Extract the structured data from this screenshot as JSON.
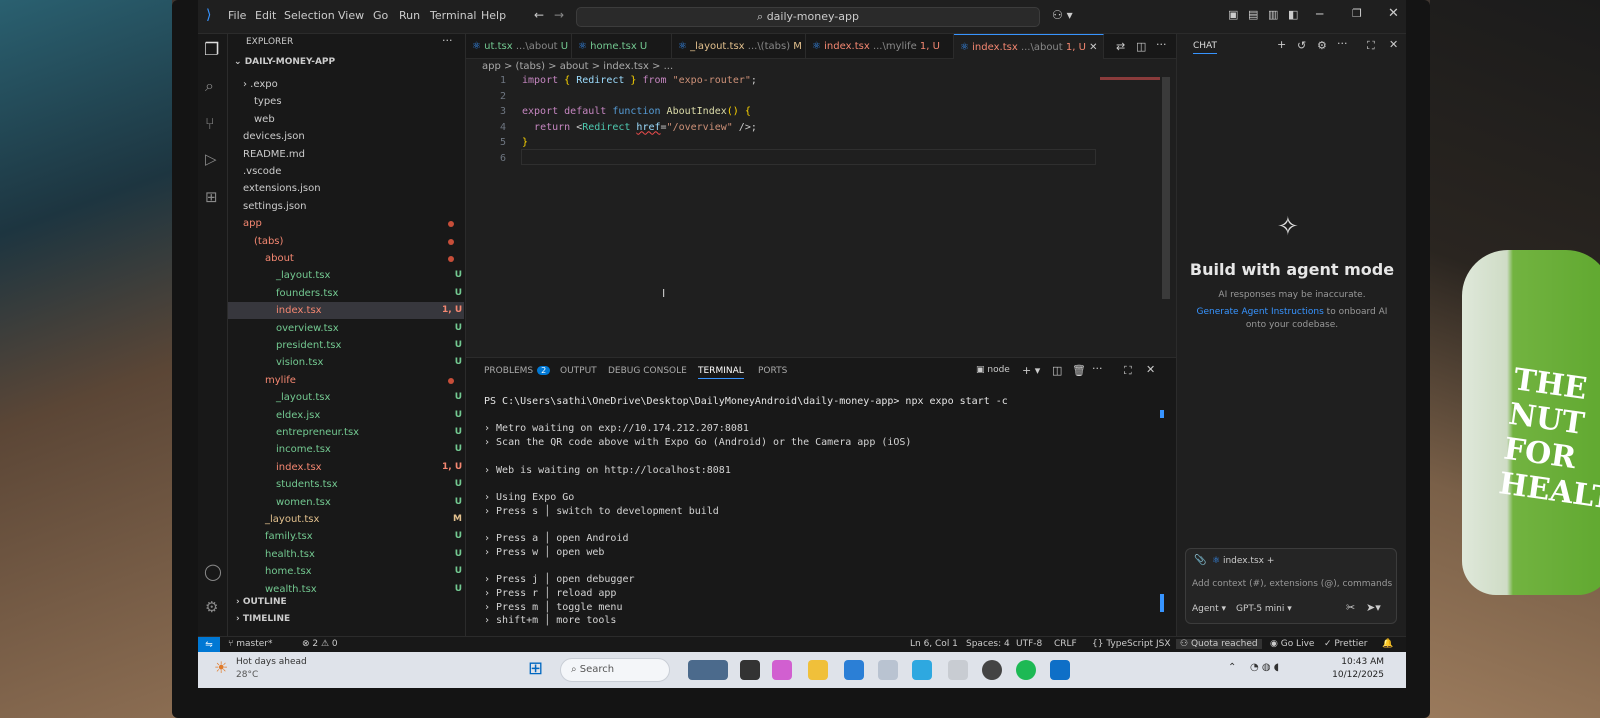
{
  "menu": [
    "File",
    "Edit",
    "Selection",
    "View",
    "Go",
    "Run",
    "Terminal",
    "Help"
  ],
  "search": "daily-money-app",
  "explorer": {
    "title": "EXPLORER",
    "root": "DAILY-MONEY-APP",
    "outline": "OUTLINE",
    "timeline": "TIMELINE"
  },
  "tree": [
    {
      "label": "› .expo",
      "depth": 1,
      "color": "w"
    },
    {
      "label": "types",
      "depth": 2,
      "color": "w"
    },
    {
      "label": "web",
      "depth": 2,
      "color": "w"
    },
    {
      "label": "devices.json",
      "depth": 1,
      "color": "w",
      "icon": "{}"
    },
    {
      "label": "README.md",
      "depth": 1,
      "color": "w",
      "icon": "ⓘ"
    },
    {
      "label": ".vscode",
      "depth": 1,
      "color": "w"
    },
    {
      "label": "extensions.json",
      "depth": 1,
      "color": "w",
      "icon": "{}"
    },
    {
      "label": "settings.json",
      "depth": 1,
      "color": "w",
      "icon": "{}"
    },
    {
      "label": "app",
      "depth": 1,
      "color": "r",
      "dot": true
    },
    {
      "label": "(tabs)",
      "depth": 2,
      "color": "r",
      "dot": true
    },
    {
      "label": "about",
      "depth": 3,
      "color": "r",
      "dot": true
    },
    {
      "label": "_layout.tsx",
      "depth": 4,
      "color": "g",
      "badge": "U"
    },
    {
      "label": "founders.tsx",
      "depth": 4,
      "color": "g",
      "badge": "U"
    },
    {
      "label": "index.tsx",
      "depth": 4,
      "color": "r",
      "badge": "1, U",
      "sel": true
    },
    {
      "label": "overview.tsx",
      "depth": 4,
      "color": "g",
      "badge": "U"
    },
    {
      "label": "president.tsx",
      "depth": 4,
      "color": "g",
      "badge": "U"
    },
    {
      "label": "vision.tsx",
      "depth": 4,
      "color": "g",
      "badge": "U"
    },
    {
      "label": "mylife",
      "depth": 3,
      "color": "r",
      "dot": true
    },
    {
      "label": "_layout.tsx",
      "depth": 4,
      "color": "g",
      "badge": "U"
    },
    {
      "label": "eldex.jsx",
      "depth": 4,
      "color": "g",
      "badge": "U"
    },
    {
      "label": "entrepreneur.tsx",
      "depth": 4,
      "color": "g",
      "badge": "U"
    },
    {
      "label": "income.tsx",
      "depth": 4,
      "color": "g",
      "badge": "U"
    },
    {
      "label": "index.tsx",
      "depth": 4,
      "color": "r",
      "badge": "1, U"
    },
    {
      "label": "students.tsx",
      "depth": 4,
      "color": "g",
      "badge": "U"
    },
    {
      "label": "women.tsx",
      "depth": 4,
      "color": "g",
      "badge": "U"
    },
    {
      "label": "_layout.tsx",
      "depth": 3,
      "color": "y",
      "badge": "M"
    },
    {
      "label": "family.tsx",
      "depth": 3,
      "color": "g",
      "badge": "U"
    },
    {
      "label": "health.tsx",
      "depth": 3,
      "color": "g",
      "badge": "U"
    },
    {
      "label": "home.tsx",
      "depth": 3,
      "color": "g",
      "badge": "U"
    },
    {
      "label": "wealth.tsx",
      "depth": 3,
      "color": "g",
      "badge": "U"
    }
  ],
  "tabs": [
    {
      "name": "ut.tsx",
      "path": "...\\about",
      "badge": "U",
      "color": "g"
    },
    {
      "name": "home.tsx",
      "path": "",
      "badge": "U",
      "color": "g"
    },
    {
      "name": "_layout.tsx",
      "path": "...\\(tabs)",
      "badge": "M",
      "color": "y"
    },
    {
      "name": "index.tsx",
      "path": "...\\mylife",
      "badge": "1, U",
      "color": "r"
    },
    {
      "name": "index.tsx",
      "path": "...\\about",
      "badge": "1, U",
      "color": "r",
      "active": true
    }
  ],
  "breadcrumb": "app > (tabs) > about > index.tsx > ...",
  "code": [
    {
      "n": "1",
      "html": "<span style='color:#c586c0'>import</span> <span style='color:#ffd700'>{</span> <span style='color:#9cdcfe'>Redirect</span> <span style='color:#ffd700'>}</span> <span style='color:#c586c0'>from</span> <span style='color:#ce9178'>\"expo-router\"</span>;"
    },
    {
      "n": "2",
      "html": ""
    },
    {
      "n": "3",
      "html": "<span style='color:#c586c0'>export</span> <span style='color:#c586c0'>default</span> <span style='color:#569cd6'>function</span> <span style='color:#dcdcaa'>AboutIndex</span><span style='color:#ffd700'>()</span> <span style='color:#ffd700'>{</span>"
    },
    {
      "n": "4",
      "html": "  <span style='color:#c586c0'>return</span> &lt;<span style='color:#4ec9b0'>Redirect</span> <span style='color:#9cdcfe;text-decoration:underline wavy #f14c4c'>href</span>=<span style='color:#ce9178'>\"/overview\"</span> /&gt;;"
    },
    {
      "n": "5",
      "html": "<span style='color:#ffd700'>}</span>"
    },
    {
      "n": "6",
      "html": ""
    }
  ],
  "panel": {
    "tabs": [
      "PROBLEMS",
      "OUTPUT",
      "DEBUG CONSOLE",
      "TERMINAL",
      "PORTS"
    ],
    "problems": "2",
    "shell": "node"
  },
  "terminal": [
    "PS C:\\Users\\sathi\\OneDrive\\Desktop\\DailyMoneyAndroid\\daily-money-app> npx expo start -c",
    "",
    "› Metro waiting on exp://10.174.212.207:8081",
    "› Scan the QR code above with Expo Go (Android) or the Camera app (iOS)",
    "",
    "› Web is waiting on http://localhost:8081",
    "",
    "› Using Expo Go",
    "› Press s │ switch to development build",
    "",
    "› Press a │ open Android",
    "› Press w │ open web",
    "",
    "› Press j │ open debugger",
    "› Press r │ reload app",
    "› Press m │ toggle menu",
    "› shift+m │ more tools"
  ],
  "chat": {
    "title": "CHAT",
    "heading": "Build with agent mode",
    "sub": "AI responses may be inaccurate.",
    "link": "Generate Agent Instructions",
    "link_rest": " to onboard AI",
    "line3": "onto your codebase.",
    "file": "index.tsx",
    "placeholder": "Add context (#), extensions (@), commands",
    "mode": "Agent",
    "model": "GPT-5 mini"
  },
  "status": {
    "branch": "master*",
    "errors": "⊗ 2 ⚠ 0",
    "pos": "Ln 6, Col 1",
    "spaces": "Spaces: 4",
    "enc": "UTF-8",
    "eol": "CRLF",
    "lang": "{} TypeScript JSX",
    "quota": "Quota reached",
    "live": "Go Live",
    "prettier": "✓ Prettier"
  },
  "taskbar": {
    "weather": "Hot days ahead",
    "temp": "28°C",
    "search": "Search",
    "time": "10:43 AM",
    "date": "10/12/2025"
  },
  "cup": "THE\nNUT\nFOR\nHEALT"
}
